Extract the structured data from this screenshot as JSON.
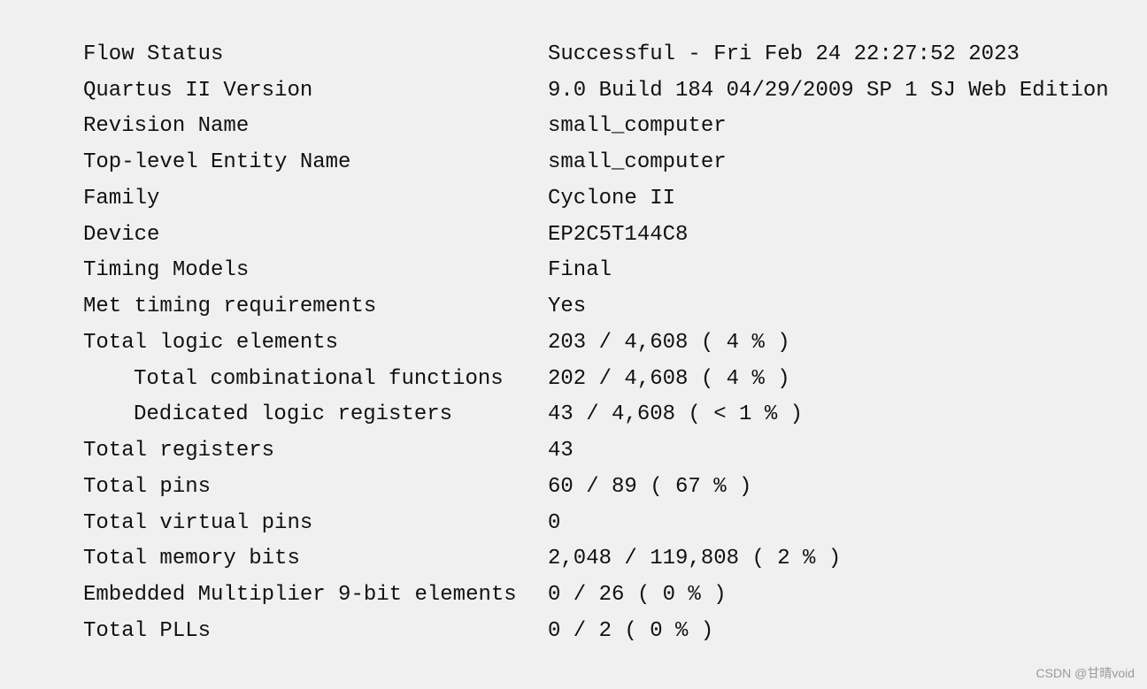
{
  "summary": {
    "rows": [
      {
        "label": "Flow Status",
        "value": "Successful - Fri Feb 24 22:27:52 2023",
        "indent": false
      },
      {
        "label": "Quartus II Version",
        "value": "9.0 Build 184 04/29/2009 SP 1 SJ Web Edition",
        "indent": false
      },
      {
        "label": "Revision Name",
        "value": "small_computer",
        "indent": false
      },
      {
        "label": "Top-level Entity Name",
        "value": "small_computer",
        "indent": false
      },
      {
        "label": "Family",
        "value": "Cyclone II",
        "indent": false
      },
      {
        "label": "Device",
        "value": "EP2C5T144C8",
        "indent": false
      },
      {
        "label": "Timing Models",
        "value": "Final",
        "indent": false
      },
      {
        "label": "Met timing requirements",
        "value": "Yes",
        "indent": false
      },
      {
        "label": "Total logic elements",
        "value": "203 / 4,608 ( 4 % )",
        "indent": false
      },
      {
        "label": "Total combinational functions",
        "value": "202 / 4,608 ( 4 % )",
        "indent": true
      },
      {
        "label": "Dedicated logic registers",
        "value": "43 / 4,608 ( < 1 % )",
        "indent": true
      },
      {
        "label": "Total registers",
        "value": "43",
        "indent": false
      },
      {
        "label": "Total pins",
        "value": "60 / 89 ( 67 % )",
        "indent": false
      },
      {
        "label": "Total virtual pins",
        "value": "0",
        "indent": false
      },
      {
        "label": "Total memory bits",
        "value": "2,048 / 119,808 ( 2 % )",
        "indent": false
      },
      {
        "label": "Embedded Multiplier 9-bit elements",
        "value": "0 / 26 ( 0 % )",
        "indent": false
      },
      {
        "label": "Total PLLs",
        "value": "0 / 2 ( 0 % )",
        "indent": false
      }
    ]
  },
  "watermark": "CSDN @甘晴void"
}
